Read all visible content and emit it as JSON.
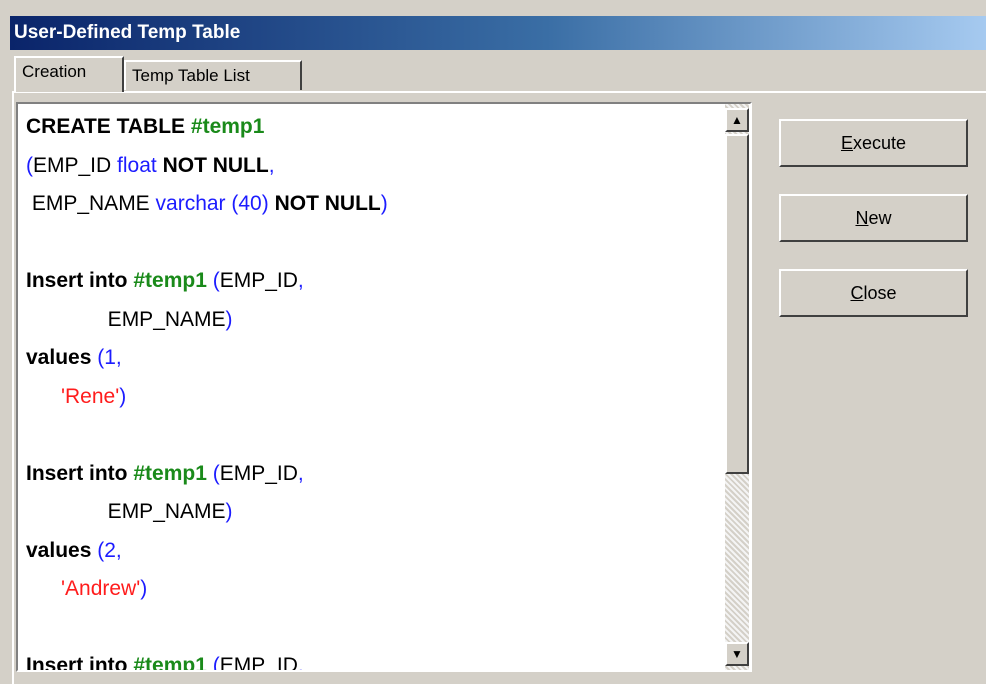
{
  "window": {
    "title": "User-Defined Temp Table"
  },
  "tabs": [
    {
      "label": "Creation",
      "active": true
    },
    {
      "label": "Temp Table List",
      "active": false
    }
  ],
  "buttons": {
    "execute": {
      "accel": "E",
      "rest": "xecute"
    },
    "new": {
      "accel": "N",
      "rest": "ew"
    },
    "close": {
      "accel": "C",
      "rest": "lose"
    }
  },
  "code_lines": [
    [
      [
        "kw",
        "CREATE TABLE "
      ],
      [
        "tbl",
        "#temp1"
      ]
    ],
    [
      [
        "blue",
        "("
      ],
      [
        "plain",
        "EMP_ID "
      ],
      [
        "blue",
        "float "
      ],
      [
        "kw",
        "NOT NULL"
      ],
      [
        "blue",
        ","
      ]
    ],
    [
      [
        "plain",
        " EMP_NAME "
      ],
      [
        "blue",
        "varchar (40) "
      ],
      [
        "kw",
        "NOT NULL"
      ],
      [
        "blue",
        ")"
      ]
    ],
    [],
    [
      [
        "kw",
        "Insert into "
      ],
      [
        "tbl",
        "#temp1"
      ],
      [
        "blue",
        " ("
      ],
      [
        "plain",
        "EMP_ID"
      ],
      [
        "blue",
        ","
      ]
    ],
    [
      [
        "plain",
        "              EMP_NAME"
      ],
      [
        "blue",
        ")"
      ]
    ],
    [
      [
        "kw",
        "values "
      ],
      [
        "blue",
        "(1,"
      ]
    ],
    [
      [
        "red",
        "      'Rene'"
      ],
      [
        "blue",
        ")"
      ]
    ],
    [],
    [
      [
        "kw",
        "Insert into "
      ],
      [
        "tbl",
        "#temp1"
      ],
      [
        "blue",
        " ("
      ],
      [
        "plain",
        "EMP_ID"
      ],
      [
        "blue",
        ","
      ]
    ],
    [
      [
        "plain",
        "              EMP_NAME"
      ],
      [
        "blue",
        ")"
      ]
    ],
    [
      [
        "kw",
        "values "
      ],
      [
        "blue",
        "(2,"
      ]
    ],
    [
      [
        "red",
        "      'Andrew'"
      ],
      [
        "blue",
        ")"
      ]
    ],
    [],
    [
      [
        "kw",
        "Insert into "
      ],
      [
        "tbl",
        "#temp1"
      ],
      [
        "blue",
        " ("
      ],
      [
        "plain",
        "EMP_ID"
      ],
      [
        "blue",
        ","
      ]
    ]
  ],
  "colors": {
    "keyword": "#000000",
    "table_name": "#1a8a1a",
    "type_punct": "#1c1cff",
    "string": "#ff1c1c",
    "title_gradient_start": "#0a246a",
    "title_gradient_end": "#a6caf0",
    "face": "#d4d0c8"
  },
  "icons": {
    "scroll_up": "triangle-up",
    "scroll_down": "triangle-down"
  }
}
